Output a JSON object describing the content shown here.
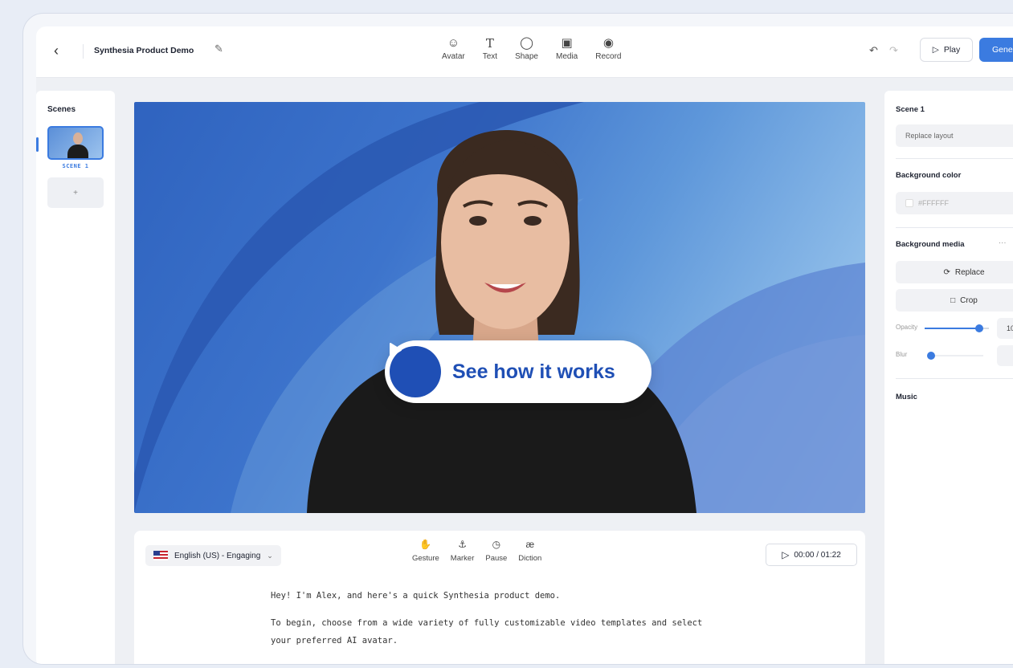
{
  "app": {
    "document_title": "Synthesia Product Demo",
    "generate_label": "Gene",
    "play_label": "Play"
  },
  "toolbar": {
    "tools": [
      {
        "label": "Avatar",
        "icon": "avatar-icon"
      },
      {
        "label": "Text",
        "icon": "text-icon"
      },
      {
        "label": "Shape",
        "icon": "shape-icon"
      },
      {
        "label": "Media",
        "icon": "media-icon"
      },
      {
        "label": "Record",
        "icon": "record-icon"
      }
    ]
  },
  "scenes": {
    "title": "Scenes",
    "items": [
      {
        "label": "SCENE 1"
      }
    ],
    "add_label": "+"
  },
  "canvas": {
    "cta_label": "See how it works"
  },
  "script": {
    "language": "English (US) - Engaging",
    "tools": [
      {
        "label": "Gesture",
        "icon": "gesture-icon"
      },
      {
        "label": "Marker",
        "icon": "marker-icon"
      },
      {
        "label": "Pause",
        "icon": "pause-icon"
      },
      {
        "label": "Diction",
        "icon": "diction-icon"
      }
    ],
    "timecode": "00:00 / 01:22",
    "paragraphs": [
      "Hey! I'm Alex, and here's a quick Synthesia product demo.",
      "To begin, choose from a wide variety of fully customizable video templates and select your preferred AI avatar."
    ]
  },
  "properties": {
    "scene_title": "Scene 1",
    "replace_layout": "Replace layout",
    "background_color_label": "Background color",
    "background_color_value": "#FFFFFF",
    "background_media_label": "Background media",
    "more_label": "···",
    "replace_label": "Replace",
    "crop_label": "Crop",
    "opacity_label": "Opacity",
    "opacity_value_text": "10",
    "opacity_level": 0.85,
    "blur_label": "Blur",
    "blur_level": 0.05,
    "music_label": "Music"
  },
  "colors": {
    "accent": "#3b7be0",
    "cta_blue": "#1f4fb5"
  }
}
